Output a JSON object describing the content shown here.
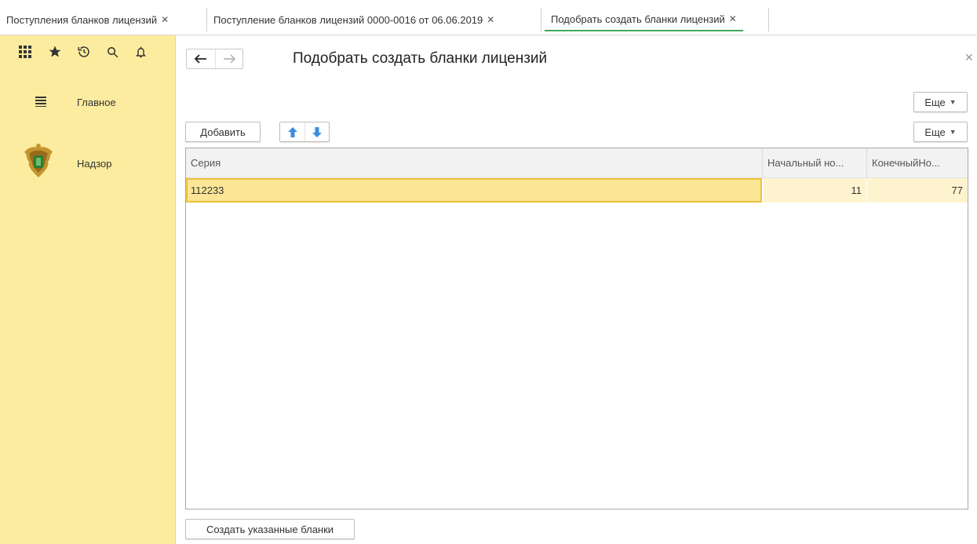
{
  "tabs": [
    {
      "label": "Поступления бланков лицензий",
      "active": false
    },
    {
      "label": "Поступление бланков лицензий 0000-0016 от 06.06.2019",
      "active": false
    },
    {
      "label": "Подобрать создать бланки лицензий",
      "active": true
    }
  ],
  "sidebar": {
    "toolbar_icons": [
      "apps-grid-icon",
      "favorites-star-icon",
      "history-icon",
      "search-icon",
      "bell-icon"
    ],
    "items": [
      {
        "label": "Главное",
        "icon": "menu-lines-icon"
      },
      {
        "label": "Надзор",
        "icon": "coat-of-arms-icon"
      }
    ]
  },
  "form": {
    "title": "Подобрать создать бланки лицензий",
    "more_label_top": "Еще",
    "add_label": "Добавить",
    "more_label_table": "Еще",
    "create_button_label": "Создать указанные бланки"
  },
  "table": {
    "columns": [
      "Серия",
      "Начальный но...",
      "КонечныйНо..."
    ],
    "rows": [
      {
        "series": "112233",
        "start": "11",
        "end": "77"
      }
    ]
  },
  "colors": {
    "sidebar_bg": "#fbec9f",
    "selected_row": "#fbe697",
    "active_tab_underline": "#3eaa5a",
    "arrow_blue": "#3b8edb"
  }
}
